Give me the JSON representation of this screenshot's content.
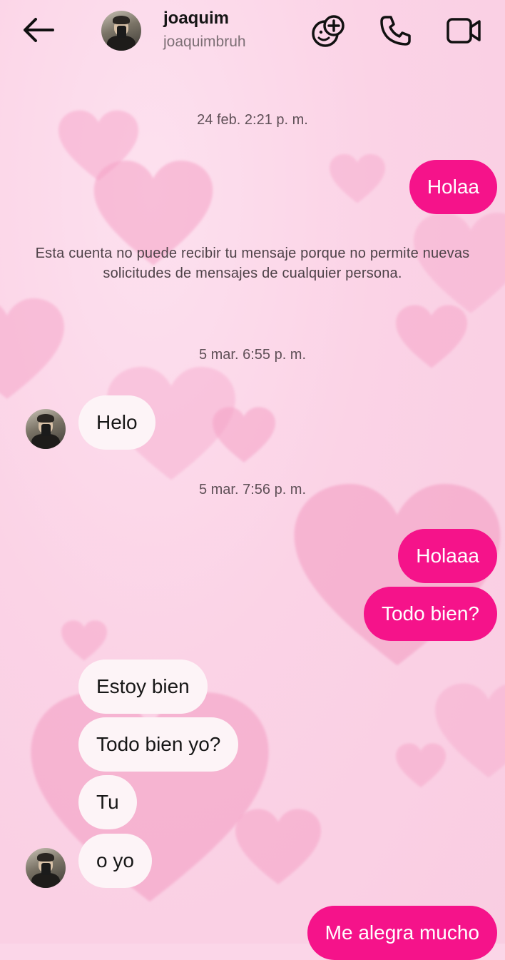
{
  "header": {
    "name": "joaquim",
    "username": "joaquimbruh",
    "icons": [
      "back-arrow-icon",
      "add-effect-icon",
      "phone-icon",
      "video-camera-icon"
    ]
  },
  "timestamps": [
    "24 feb. 2:21 p. m.",
    "5 mar. 6:55 p. m.",
    "5 mar. 7:56 p. m."
  ],
  "notice": "Esta cuenta no puede recibir tu mensaje porque no permite nuevas solicitudes de mensajes de cualquier persona.",
  "messages": [
    {
      "sender": "me",
      "text": "Holaa"
    },
    {
      "sender": "them",
      "text": "Helo"
    },
    {
      "sender": "me",
      "text": "Holaaa"
    },
    {
      "sender": "me",
      "text": "Todo bien?"
    },
    {
      "sender": "them",
      "text": "Estoy bien"
    },
    {
      "sender": "them",
      "text": "Todo bien yo?"
    },
    {
      "sender": "them",
      "text": "Tu"
    },
    {
      "sender": "them",
      "text": "o yo"
    },
    {
      "sender": "me",
      "text": "Me alegra mucho"
    }
  ],
  "colors": {
    "outgoing_bubble": "#f5138a",
    "incoming_bubble": "#fdf4f7",
    "background": "#fbd6e8"
  }
}
